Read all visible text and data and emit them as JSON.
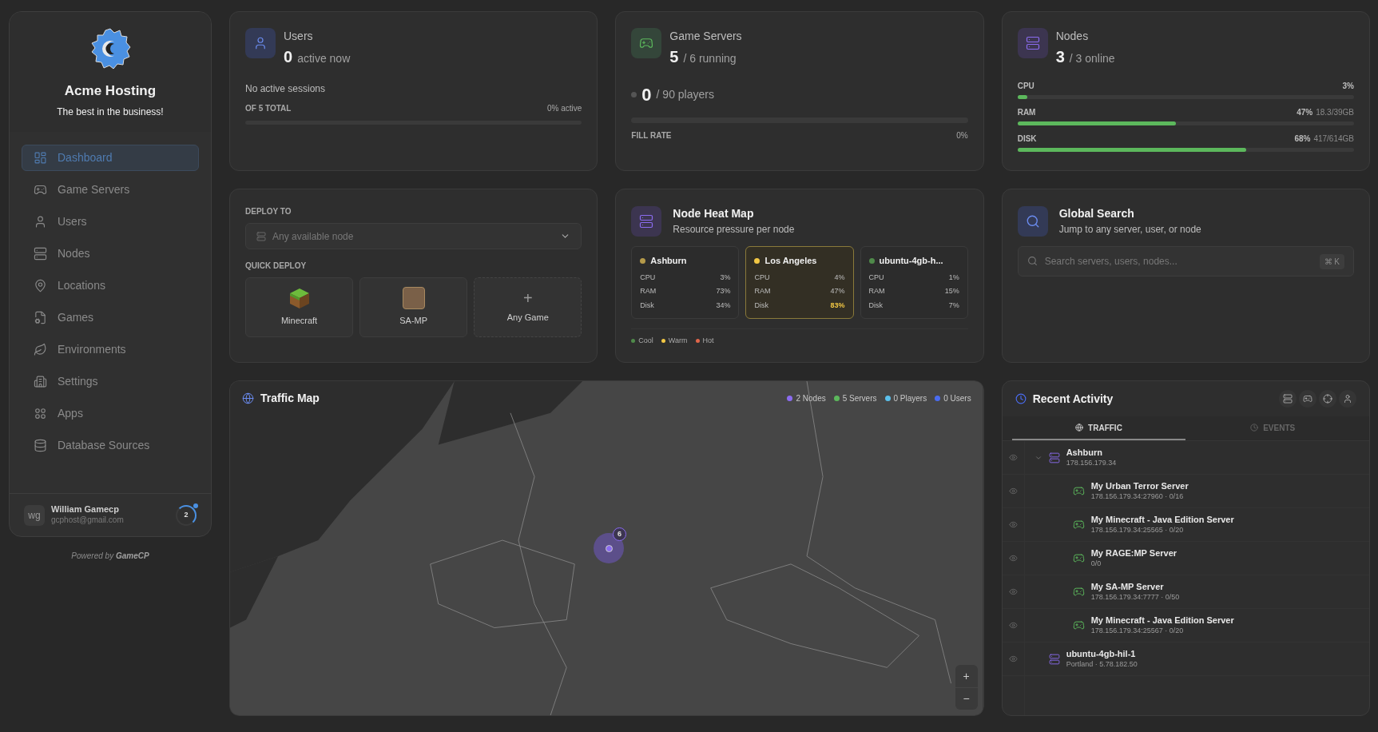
{
  "brand": {
    "name": "Acme Hosting",
    "tagline": "The best in the business!"
  },
  "nav": [
    {
      "label": "Dashboard",
      "selected": true
    },
    {
      "label": "Game Servers",
      "selected": false
    },
    {
      "label": "Users",
      "selected": false
    },
    {
      "label": "Nodes",
      "selected": false
    },
    {
      "label": "Locations",
      "selected": false
    },
    {
      "label": "Games",
      "selected": false
    },
    {
      "label": "Environments",
      "selected": false
    },
    {
      "label": "Settings",
      "selected": false
    },
    {
      "label": "Apps",
      "selected": false
    },
    {
      "label": "Database Sources",
      "selected": false
    }
  ],
  "account": {
    "initials": "wg",
    "name": "William Gamecp",
    "email": "gcphost@gmail.com",
    "badge": "2"
  },
  "powered_by": {
    "label": "Powered by",
    "brand": "GameCP"
  },
  "users_card": {
    "title": "Users",
    "value": "0",
    "suffix": "active now",
    "note": "No active sessions",
    "total_label": "OF 5 TOTAL",
    "active_label": "0% active",
    "level": 0
  },
  "servers_card": {
    "title": "Game Servers",
    "value": "5",
    "suffix": "/ 6 running",
    "players": "0",
    "players_suffix": "/ 90 players",
    "fill_label": "FILL RATE",
    "fill_value": "0%",
    "level": 0
  },
  "nodes_card": {
    "title": "Nodes",
    "value": "3",
    "suffix": "/ 3 online",
    "meters": [
      {
        "label": "CPU",
        "percent": "3%",
        "level": 0.03
      },
      {
        "label": "RAM",
        "percent": "47%",
        "detail": "18.3/39GB",
        "level": 0.47
      },
      {
        "label": "DISK",
        "percent": "68%",
        "detail": "417/614GB",
        "level": 0.68
      }
    ]
  },
  "deploy": {
    "label": "DEPLOY TO",
    "select_placeholder": "Any available node",
    "quick_label": "QUICK DEPLOY",
    "games": [
      {
        "kind": "block",
        "label": "Minecraft"
      },
      {
        "kind": "photo",
        "label": "SA-MP"
      },
      {
        "kind": "add",
        "icon": "+",
        "label": "Any Game"
      }
    ]
  },
  "heatmap": {
    "title": "Node Heat Map",
    "subtitle": "Resource pressure per node",
    "nodes": [
      {
        "name": "Ashburn",
        "color": "#b59a4a",
        "selected": false,
        "metrics": [
          {
            "label": "CPU",
            "value": "3%",
            "warn": false
          },
          {
            "label": "RAM",
            "value": "73%",
            "warn": false
          },
          {
            "label": "Disk",
            "value": "34%",
            "warn": false
          }
        ]
      },
      {
        "name": "Los Angeles",
        "color": "#f2c744",
        "selected": true,
        "metrics": [
          {
            "label": "CPU",
            "value": "4%",
            "warn": false
          },
          {
            "label": "RAM",
            "value": "47%",
            "warn": false
          },
          {
            "label": "Disk",
            "value": "83%",
            "warn": true
          }
        ]
      },
      {
        "name": "ubuntu-4gb-h...",
        "color": "#4f8a4a",
        "selected": false,
        "metrics": [
          {
            "label": "CPU",
            "value": "1%",
            "warn": false
          },
          {
            "label": "RAM",
            "value": "15%",
            "warn": false
          },
          {
            "label": "Disk",
            "value": "7%",
            "warn": false
          }
        ]
      }
    ],
    "legend": [
      {
        "label": "Cool",
        "color": "#4f8a4a"
      },
      {
        "label": "Warm",
        "color": "#f2c744"
      },
      {
        "label": "Hot",
        "color": "#e0664a"
      }
    ]
  },
  "search": {
    "title": "Global Search",
    "subtitle": "Jump to any server, user, or node",
    "placeholder": "Search servers, users, nodes...",
    "shortcut": "⌘ K"
  },
  "traffic_map": {
    "title": "Traffic Map",
    "legend": [
      {
        "label": "2 Nodes",
        "color": "#8b6cf0"
      },
      {
        "label": "5 Servers",
        "color": "#5cb85c"
      },
      {
        "label": "0 Players",
        "color": "#5bc0eb"
      },
      {
        "label": "0 Users",
        "color": "#4a6cf0"
      }
    ],
    "cluster": "6",
    "zoom_in": "+",
    "zoom_out": "−"
  },
  "activity": {
    "title": "Recent Activity",
    "tabs": [
      {
        "label": "TRAFFIC",
        "selected": true
      },
      {
        "label": "EVENTS",
        "selected": false
      }
    ],
    "rows": [
      {
        "kind": "node",
        "name": "Ashburn",
        "detail": "178.156.179.34",
        "children": [
          {
            "kind": "server",
            "name": "My Urban Terror Server",
            "detail": "178.156.179.34:27960 · 0/16"
          },
          {
            "kind": "server",
            "name": "My Minecraft - Java Edition Server",
            "detail": "178.156.179.34:25565 · 0/20"
          },
          {
            "kind": "server",
            "name": "My RAGE:MP Server",
            "detail": "0/0"
          },
          {
            "kind": "server",
            "name": "My SA-MP Server",
            "detail": "178.156.179.34:7777 · 0/50"
          },
          {
            "kind": "server",
            "name": "My Minecraft - Java Edition Server",
            "detail": "178.156.179.34:25567 · 0/20"
          }
        ]
      },
      {
        "kind": "node",
        "name": "ubuntu-4gb-hil-1",
        "detail": "Portland · 5.78.182.50"
      }
    ]
  }
}
